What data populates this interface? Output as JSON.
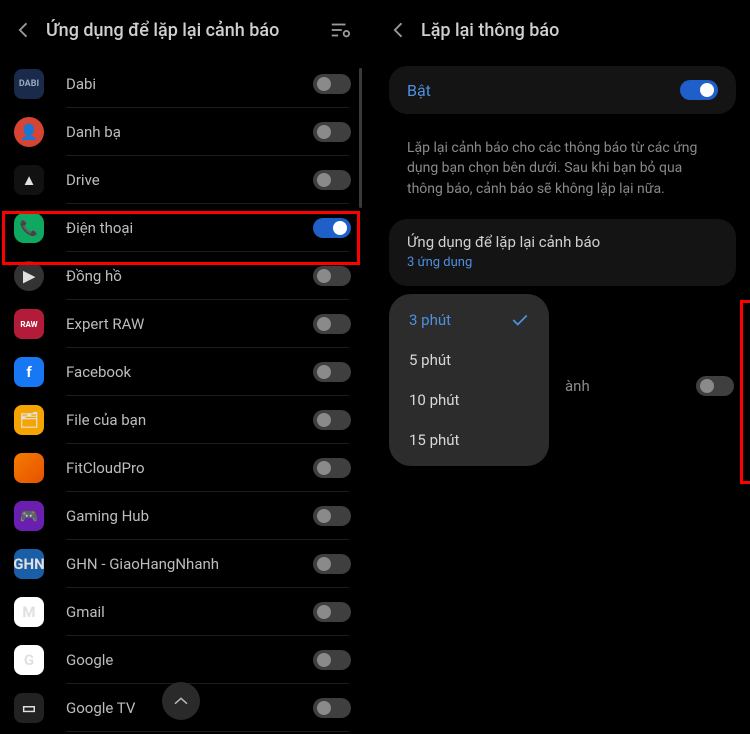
{
  "left": {
    "title": "Ứng dụng để lặp lại cảnh báo",
    "apps": [
      {
        "name": "Dabi",
        "on": false,
        "icon": "dabi",
        "glyph": "DABI"
      },
      {
        "name": "Danh bạ",
        "on": false,
        "icon": "danhba",
        "glyph": "👤"
      },
      {
        "name": "Drive",
        "on": false,
        "icon": "drive",
        "glyph": "▲"
      },
      {
        "name": "Điện thoại",
        "on": true,
        "icon": "phone",
        "glyph": "📞"
      },
      {
        "name": "Đồng hồ",
        "on": false,
        "icon": "dongho",
        "glyph": "▶"
      },
      {
        "name": "Expert RAW",
        "on": false,
        "icon": "raw",
        "glyph": "RAW"
      },
      {
        "name": "Facebook",
        "on": false,
        "icon": "fb",
        "glyph": "f"
      },
      {
        "name": "File của bạn",
        "on": false,
        "icon": "files",
        "glyph": "🗂"
      },
      {
        "name": "FitCloudPro",
        "on": false,
        "icon": "fitcloud",
        "glyph": ""
      },
      {
        "name": "Gaming Hub",
        "on": false,
        "icon": "gaming",
        "glyph": "🎮"
      },
      {
        "name": "GHN - GiaoHangNhanh",
        "on": false,
        "icon": "ghn",
        "glyph": "GHN"
      },
      {
        "name": "Gmail",
        "on": false,
        "icon": "gmail",
        "glyph": "M"
      },
      {
        "name": "Google",
        "on": false,
        "icon": "google",
        "glyph": "G"
      },
      {
        "name": "Google TV",
        "on": false,
        "icon": "gtv",
        "glyph": "▭"
      }
    ]
  },
  "right": {
    "title": "Lặp lại thông báo",
    "enable_label": "Bật",
    "enable_on": true,
    "description": "Lặp lại cảnh báo cho các thông báo từ các ứng dụng bạn chọn bên dưới. Sau khi bạn bỏ qua thông báo, cảnh báo sẽ không lặp lại nữa.",
    "apps_section_title": "Ứng dụng để lặp lại cảnh báo",
    "apps_section_sub": "3 ứng dụng",
    "flash_label": "ành",
    "flash_on": false,
    "interval_options": [
      {
        "label": "3 phút",
        "selected": true
      },
      {
        "label": "5 phút",
        "selected": false
      },
      {
        "label": "10 phút",
        "selected": false
      },
      {
        "label": "15 phút",
        "selected": false
      }
    ]
  }
}
